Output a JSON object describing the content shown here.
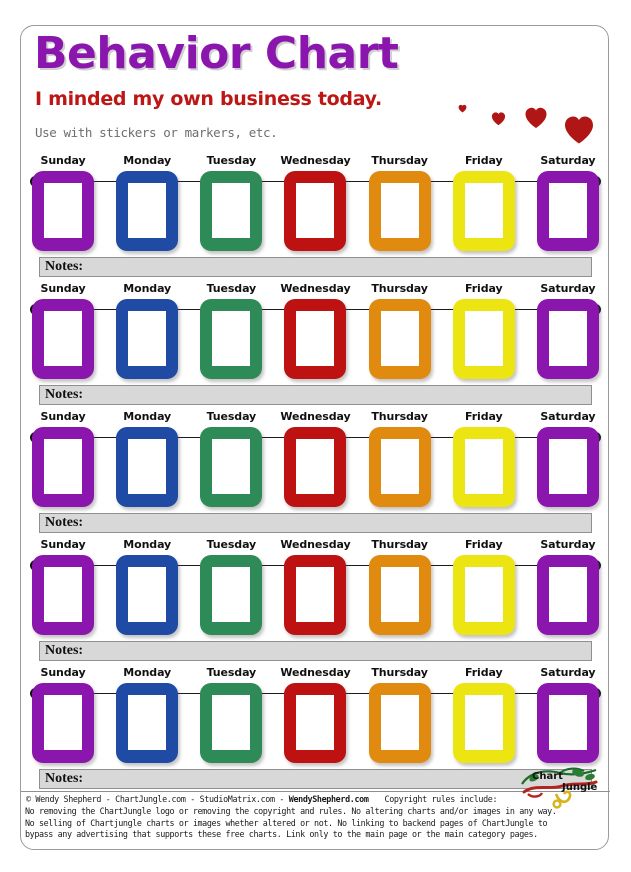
{
  "header": {
    "title": "Behavior Chart",
    "subtitle": "I minded my own business today.",
    "tagline": "Use  with stickers or markers, etc.",
    "title_color": "#8A16AE",
    "subtitle_color": "#BE1515",
    "tagline_color": "#6E6E6E",
    "heart_color": "#B01616",
    "hearts": [
      {
        "size": 9
      },
      {
        "size": 15
      },
      {
        "size": 24
      },
      {
        "size": 32
      }
    ]
  },
  "days": [
    {
      "label": "Sunday",
      "color": "#8A16AE"
    },
    {
      "label": "Monday",
      "color": "#1F4BA5"
    },
    {
      "label": "Tuesday",
      "color": "#2E8B57"
    },
    {
      "label": "Wednesday",
      "color": "#BE1212"
    },
    {
      "label": "Thursday",
      "color": "#E08A10"
    },
    {
      "label": "Friday",
      "color": "#EDE511"
    },
    {
      "label": "Saturday",
      "color": "#8A16AE"
    }
  ],
  "notes_label": "Notes:",
  "row_count": 5,
  "rows": [
    {
      "notes_value": ""
    },
    {
      "notes_value": ""
    },
    {
      "notes_value": ""
    },
    {
      "notes_value": ""
    },
    {
      "notes_value": ""
    }
  ],
  "footer": {
    "copyright_symbol": "©",
    "credit_main": "© Wendy Shepherd - ChartJungle.com - StudioMatrix.com - ",
    "credit_bold": "WendyShepherd.com",
    "credit_tail": "Copyright rules include:",
    "rules_line1": "No removing the ChartJungle logo or removing the copyright and rules. No altering charts and/or images in any way.",
    "rules_line2": "No selling of Chartjungle charts or images whether altered or not. No linking to backend pages of ChartJungle to",
    "rules_line3": "bypass any advertising that supports these free charts. Link only to the main page or the main category pages.",
    "logo_text_top": "Chart",
    "logo_text_bottom": "Jungle"
  }
}
